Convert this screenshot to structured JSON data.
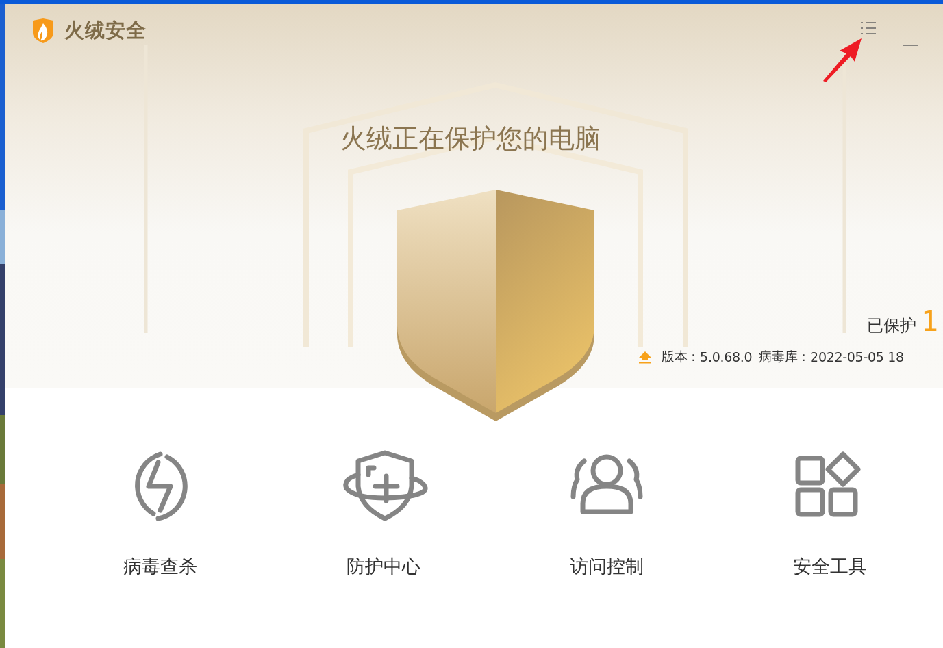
{
  "app": {
    "name": "火绒安全"
  },
  "headline": "火绒正在保护您的电脑",
  "status": {
    "label": "已保护",
    "count": "1"
  },
  "version_line": {
    "version_label": "版本：",
    "version": "5.0.68.0",
    "db_label": "病毒库：",
    "db_date": "2022-05-05 18"
  },
  "features": [
    {
      "kind": "scan",
      "label": "病毒查杀"
    },
    {
      "kind": "protect",
      "label": "防护中心"
    },
    {
      "kind": "access",
      "label": "访问控制"
    },
    {
      "kind": "tools",
      "label": "安全工具"
    }
  ]
}
